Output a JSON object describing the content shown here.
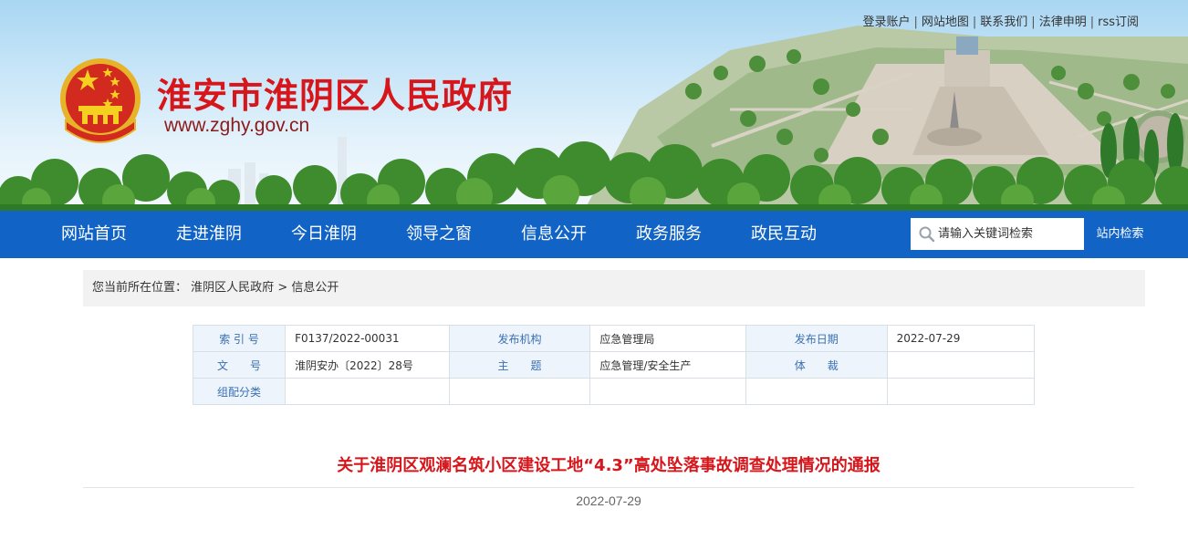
{
  "header": {
    "top_links": [
      "登录账户",
      "网站地图",
      "联系我们",
      "法律申明",
      "rss订阅"
    ],
    "site_title": "淮安市淮阴区人民政府",
    "site_url": "www.zghy.gov.cn"
  },
  "nav": {
    "items": [
      "网站首页",
      "走进淮阴",
      "今日淮阴",
      "领导之窗",
      "信息公开",
      "政务服务",
      "政民互动"
    ]
  },
  "search": {
    "placeholder": "请输入关键词检索",
    "button_label": "站内检索"
  },
  "breadcrumb": {
    "prefix": "您当前所在位置：",
    "items": [
      "淮阴区人民政府",
      "信息公开"
    ],
    "separator": ">"
  },
  "meta_table": {
    "rows": [
      [
        {
          "label": "索 引 号",
          "value": "F0137/2022-00031"
        },
        {
          "label": "发布机构",
          "value": "应急管理局"
        },
        {
          "label": "发布日期",
          "value": "2022-07-29"
        }
      ],
      [
        {
          "label": "文　　号",
          "value": "淮阴安办〔2022〕28号"
        },
        {
          "label": "主　　题",
          "value": "应急管理/安全生产"
        },
        {
          "label": "体　　裁",
          "value": ""
        }
      ],
      [
        {
          "label": "组配分类",
          "value": ""
        },
        {
          "label": "",
          "value": ""
        },
        {
          "label": "",
          "value": ""
        }
      ]
    ]
  },
  "article": {
    "title": "关于淮阴区观澜名筑小区建设工地“4.3”高处坠落事故调查处理情况的通报",
    "date": "2022-07-29"
  },
  "colors": {
    "brand_red": "#d6161b",
    "nav_blue": "#1164c6",
    "label_blue": "#3a6fb5"
  }
}
